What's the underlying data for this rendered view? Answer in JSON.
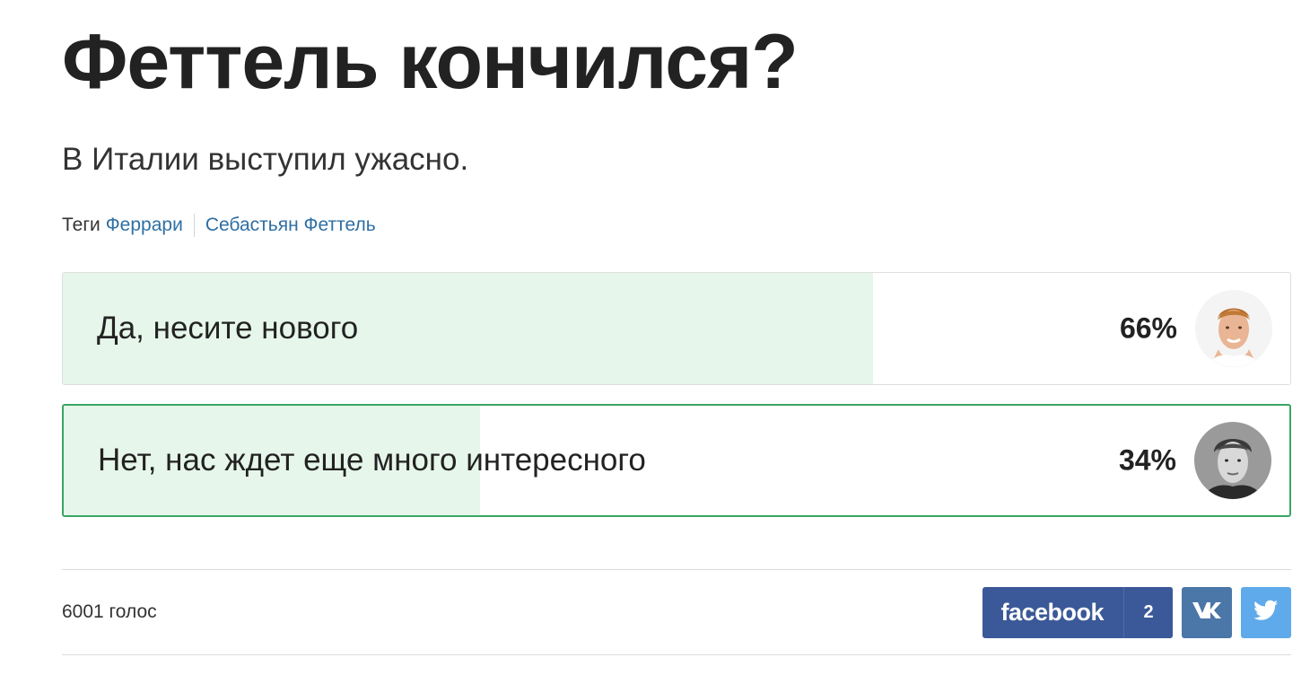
{
  "poll": {
    "title": "Феттель кончился?",
    "subtitle": "В Италии выступил ужасно.",
    "tags": {
      "label": "Теги",
      "items": [
        "Феррари",
        "Себастьян Феттель"
      ]
    },
    "options": [
      {
        "label": "Да, несите нового",
        "percent_text": "66%",
        "percent": 66,
        "avatar": "driver-avatar-young",
        "selected": false
      },
      {
        "label": "Нет, нас ждет еще много интересного",
        "percent_text": "34%",
        "percent": 34,
        "avatar": "driver-avatar-vettel",
        "selected": true
      }
    ],
    "votes_text": "6001 голос"
  },
  "share": {
    "facebook_label": "facebook",
    "facebook_count": "2",
    "vk_icon": "vk-icon",
    "twitter_icon": "twitter-bird-icon"
  },
  "colors": {
    "fill": "#e6f6ea",
    "selected_border": "#3aa563",
    "facebook": "#3b5998",
    "vk": "#4a76a8",
    "twitter": "#5eaaea",
    "tag_link": "#2f6fa3"
  }
}
